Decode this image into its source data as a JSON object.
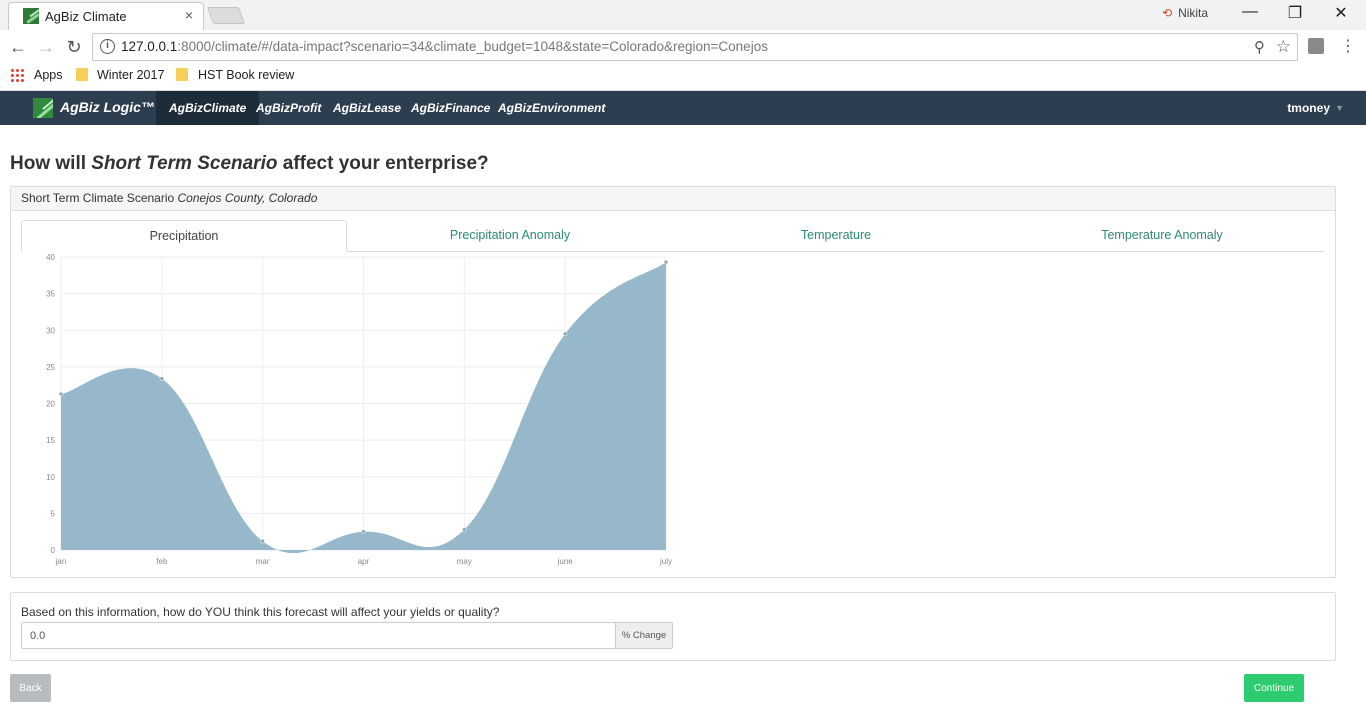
{
  "browser": {
    "tab_title": "AgBiz Climate",
    "tab_close": "×",
    "profile_name": "Nikita",
    "url_host": "127.0.0.1",
    "url_rest": ":8000/climate/#/data-impact?scenario=34&climate_budget=1048&state=Colorado&region=Conejos",
    "bookmarks": [
      "Apps",
      "Winter 2017",
      "HST Book review"
    ]
  },
  "nav": {
    "brand": "AgBiz Logic™",
    "items": [
      "AgBizClimate",
      "AgBizProfit",
      "AgBizLease",
      "AgBizFinance",
      "AgBizEnvironment"
    ],
    "active_index": 0,
    "user": "tmoney"
  },
  "page": {
    "title_prefix": "How will ",
    "title_scenario": "Short Term Scenario",
    "title_suffix": " affect your enterprise?",
    "panel_heading_prefix": "Short Term Climate Scenario ",
    "panel_heading_location": "Conejos County, Colorado",
    "tabs": [
      "Precipitation",
      "Precipitation Anomaly",
      "Temperature",
      "Temperature Anomaly"
    ],
    "active_tab": 0
  },
  "chart_data": {
    "type": "area",
    "categories": [
      "jan",
      "feb",
      "mar",
      "apr",
      "may",
      "june",
      "july"
    ],
    "values": [
      21.3,
      23.4,
      1.2,
      2.5,
      2.8,
      29.5,
      39.3
    ],
    "ylim": [
      0,
      40
    ],
    "yticks": [
      0,
      5,
      10,
      15,
      20,
      25,
      30,
      35,
      40
    ],
    "grid": true,
    "fill_color": "#97b8cb",
    "point_color": "#8aa8ba"
  },
  "question": {
    "label": "Based on this information, how do YOU think this forecast will affect your yields or quality?",
    "value": "0.0",
    "addon": "% Change"
  },
  "buttons": {
    "back": "Back",
    "continue": "Continue"
  }
}
